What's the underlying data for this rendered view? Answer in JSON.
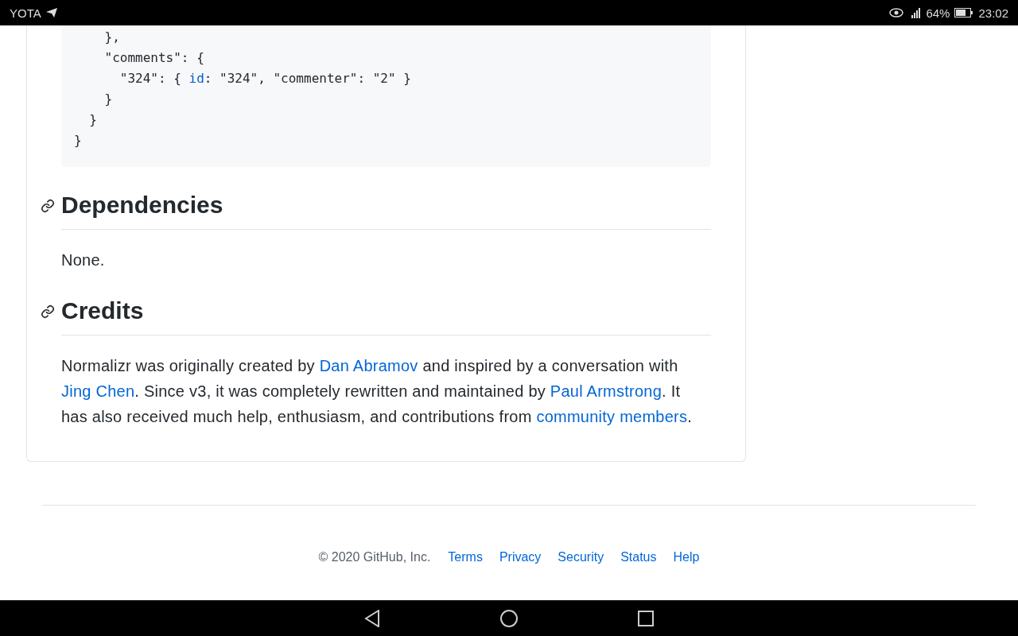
{
  "status_bar": {
    "carrier": "YOTA",
    "battery": "64%",
    "time": "23:02"
  },
  "code_lines": [
    [
      {
        "text": "    },",
        "kind": "plain"
      }
    ],
    [
      {
        "text": "    \"comments\": {",
        "kind": "plain"
      }
    ],
    [
      {
        "text": "      \"324\": { ",
        "kind": "plain"
      },
      {
        "text": "id",
        "kind": "key"
      },
      {
        "text": ": \"324\", \"commenter\": \"2\" }",
        "kind": "plain"
      }
    ],
    [
      {
        "text": "    }",
        "kind": "plain"
      }
    ],
    [
      {
        "text": "  }",
        "kind": "plain"
      }
    ],
    [
      {
        "text": "}",
        "kind": "plain"
      }
    ]
  ],
  "sections": [
    {
      "heading": "Dependencies",
      "paragraph": [
        {
          "text": "None.",
          "kind": "text"
        }
      ]
    },
    {
      "heading": "Credits",
      "paragraph": [
        {
          "text": "Normalizr was originally created by ",
          "kind": "text"
        },
        {
          "text": "Dan Abramov",
          "kind": "link"
        },
        {
          "text": " and inspired by a conversation with ",
          "kind": "text"
        },
        {
          "text": "Jing Chen",
          "kind": "link"
        },
        {
          "text": ". Since v3, it was completely rewritten and maintained by ",
          "kind": "text"
        },
        {
          "text": "Paul Armstrong",
          "kind": "link"
        },
        {
          "text": ". It has also received much help, enthusiasm, and contributions from ",
          "kind": "text"
        },
        {
          "text": "community ",
          "kind": "link"
        },
        {
          "text": "members",
          "kind": "link"
        },
        {
          "text": ".",
          "kind": "text"
        }
      ]
    }
  ],
  "footer": {
    "copyright": "© 2020 GitHub, Inc.",
    "links": [
      "Terms",
      "Privacy",
      "Security",
      "Status",
      "Help"
    ]
  }
}
